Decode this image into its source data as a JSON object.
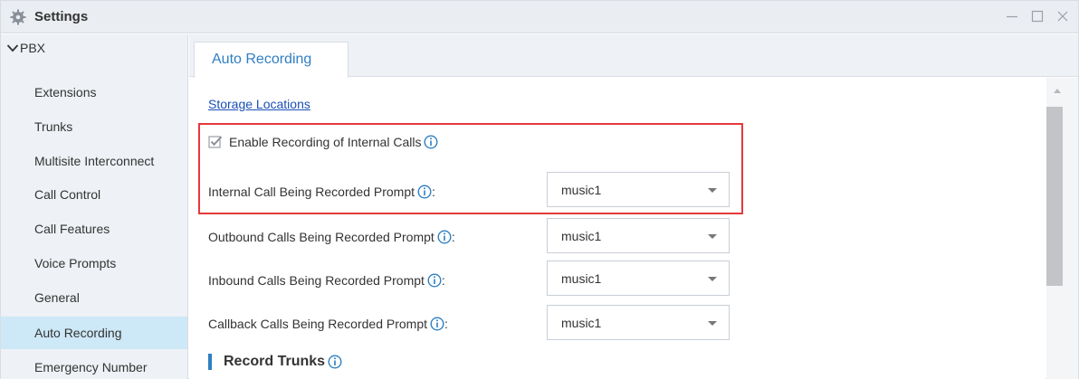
{
  "window": {
    "title": "Settings"
  },
  "sidebar": {
    "group_label": "PBX",
    "items": [
      {
        "label": "Extensions"
      },
      {
        "label": "Trunks"
      },
      {
        "label": "Multisite Interconnect"
      },
      {
        "label": "Call Control"
      },
      {
        "label": "Call Features"
      },
      {
        "label": "Voice Prompts"
      },
      {
        "label": "General"
      },
      {
        "label": "Auto Recording",
        "active": true
      },
      {
        "label": "Emergency Number"
      }
    ]
  },
  "tabs": [
    {
      "label": "Auto Recording",
      "active": true
    }
  ],
  "main": {
    "storage_link": "Storage Locations",
    "enable_internal": {
      "label": "Enable Recording of Internal Calls",
      "checked": true
    },
    "prompts": [
      {
        "label": "Internal Call Being Recorded Prompt",
        "suffix": ":",
        "value": "music1"
      },
      {
        "label": "Outbound Calls Being Recorded Prompt",
        "suffix": ":",
        "value": "music1"
      },
      {
        "label": "Inbound Calls Being Recorded Prompt",
        "suffix": ":",
        "value": "music1"
      },
      {
        "label": "Callback Calls Being Recorded Prompt",
        "suffix": ":",
        "value": "music1"
      }
    ],
    "section_title": "Record Trunks"
  },
  "colors": {
    "accent": "#2f7fc2",
    "highlight_border": "#e5383b",
    "active_item_bg": "#cde8f7",
    "link": "#1a4fb8"
  }
}
